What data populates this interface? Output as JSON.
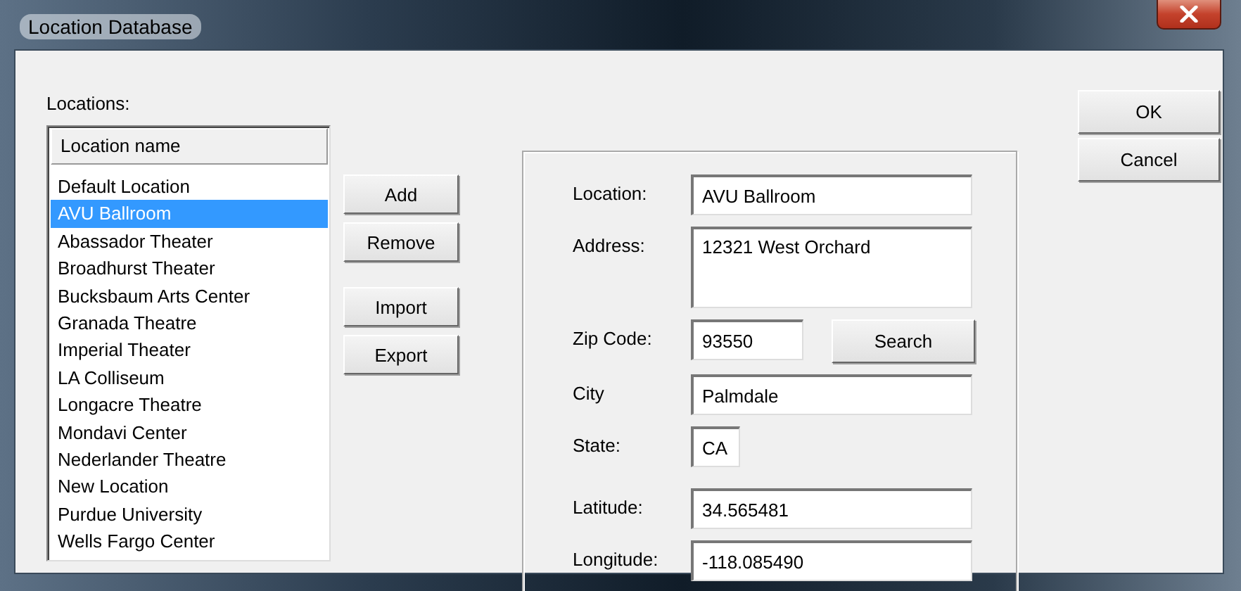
{
  "window": {
    "title": "Location Database"
  },
  "locations": {
    "label": "Locations:",
    "column_header": "Location name",
    "items": [
      {
        "name": "Default Location",
        "selected": false
      },
      {
        "name": "AVU Ballroom",
        "selected": true
      },
      {
        "name": "Abassador Theater",
        "selected": false
      },
      {
        "name": "Broadhurst Theater",
        "selected": false
      },
      {
        "name": "Bucksbaum Arts Center",
        "selected": false
      },
      {
        "name": "Granada Theatre",
        "selected": false
      },
      {
        "name": "Imperial Theater",
        "selected": false
      },
      {
        "name": "LA Colliseum",
        "selected": false
      },
      {
        "name": "Longacre Theatre",
        "selected": false
      },
      {
        "name": "Mondavi Center",
        "selected": false
      },
      {
        "name": "Nederlander Theatre",
        "selected": false
      },
      {
        "name": "New Location",
        "selected": false
      },
      {
        "name": "Purdue University",
        "selected": false
      },
      {
        "name": "Wells Fargo Center",
        "selected": false
      }
    ]
  },
  "list_buttons": [
    [
      "Add",
      "Remove"
    ],
    [
      "Import",
      "Export"
    ]
  ],
  "form": {
    "groups": [
      [
        {
          "label": "Location:",
          "value": "AVU Ballroom",
          "kind": "text"
        },
        {
          "label": "Address:",
          "value": "12321 West Orchard",
          "kind": "multiline"
        },
        {
          "label": "Zip Code:",
          "value": "93550",
          "kind": "short",
          "button": "Search"
        },
        {
          "label": "City",
          "value": "Palmdale",
          "kind": "text"
        },
        {
          "label": "State:",
          "value": "CA",
          "kind": "tiny"
        }
      ],
      [
        {
          "label": "Latitude:",
          "value": "34.565481",
          "kind": "text"
        },
        {
          "label": "Longitude:",
          "value": "-118.085490",
          "kind": "text"
        }
      ]
    ]
  },
  "dialog_buttons": [
    "OK",
    "Cancel"
  ]
}
